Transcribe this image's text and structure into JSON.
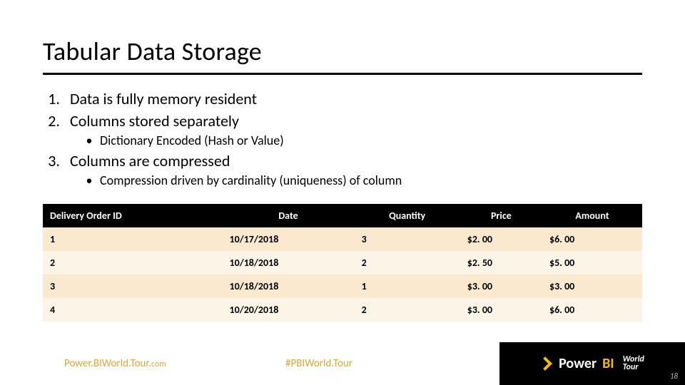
{
  "title": "Tabular Data Storage",
  "list": {
    "item1": "Data is fully memory resident",
    "item2": "Columns stored separately",
    "item2_sub": "Dictionary Encoded (Hash or Value)",
    "item3": "Columns are compressed",
    "item3_sub": "Compression driven by cardinality (uniqueness) of column"
  },
  "table": {
    "headers": {
      "c1": "Delivery Order ID",
      "c2": "Date",
      "c3": "Quantity",
      "c4": "Price",
      "c5": "Amount"
    },
    "rows": [
      {
        "id": "1",
        "date": "10/17/2018",
        "qty": "3",
        "price": "$2. 00",
        "amount": "$6. 00"
      },
      {
        "id": "2",
        "date": "10/18/2018",
        "qty": "2",
        "price": "$2. 50",
        "amount": "$5. 00"
      },
      {
        "id": "3",
        "date": "10/18/2018",
        "qty": "1",
        "price": "$3. 00",
        "amount": "$3. 00"
      },
      {
        "id": "4",
        "date": "10/20/2018",
        "qty": "2",
        "price": "$3. 00",
        "amount": "$6. 00"
      }
    ]
  },
  "footer": {
    "site_main": "Power.BIWorld.Tour.",
    "site_tld": "com",
    "hashtag": "#PBIWorld.Tour",
    "brand_a": "Power",
    "brand_b": "BI",
    "brand_stack_top": "World",
    "brand_stack_bot": "Tour",
    "page": "18"
  },
  "chart_data": {
    "type": "table",
    "title": "Tabular Data Storage",
    "columns": [
      "Delivery Order ID",
      "Date",
      "Quantity",
      "Price",
      "Amount"
    ],
    "rows": [
      [
        1,
        "10/17/2018",
        3,
        2.0,
        6.0
      ],
      [
        2,
        "10/18/2018",
        2,
        2.5,
        5.0
      ],
      [
        3,
        "10/18/2018",
        1,
        3.0,
        3.0
      ],
      [
        4,
        "10/20/2018",
        2,
        3.0,
        6.0
      ]
    ]
  }
}
